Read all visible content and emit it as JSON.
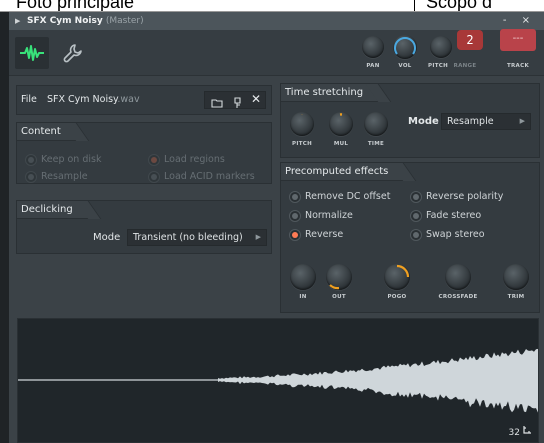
{
  "background": {
    "left_text": "Foto principale",
    "right_text": "Scopo d"
  },
  "window": {
    "title": "SFX Cym Noisy",
    "subtitle": "(Master)",
    "controls": "- ×"
  },
  "toolbar": {
    "knobs": {
      "pan": "PAN",
      "vol": "VOL",
      "pitch": "PITCH",
      "range": "RANGE",
      "track": "TRACK"
    },
    "range_value": "2",
    "track_value": "---"
  },
  "file": {
    "label": "File",
    "name": "SFX Cym Noisy",
    "ext": ".wav"
  },
  "content": {
    "title": "Content",
    "options": [
      {
        "label": "Keep on disk",
        "on": false
      },
      {
        "label": "Load regions",
        "on": true
      },
      {
        "label": "Resample",
        "on": false
      },
      {
        "label": "Load ACID markers",
        "on": false
      }
    ]
  },
  "declicking": {
    "title": "Declicking",
    "mode_label": "Mode",
    "mode_value": "Transient (no bleeding)"
  },
  "time_stretching": {
    "title": "Time stretching",
    "knobs": [
      "PITCH",
      "MUL",
      "TIME"
    ],
    "mode_label": "Mode",
    "mode_value": "Resample"
  },
  "precomputed": {
    "title": "Precomputed effects",
    "options": [
      {
        "label": "Remove DC offset",
        "on": false
      },
      {
        "label": "Reverse polarity",
        "on": false
      },
      {
        "label": "Normalize",
        "on": false
      },
      {
        "label": "Fade stereo",
        "on": false
      },
      {
        "label": "Reverse",
        "on": true
      },
      {
        "label": "Swap stereo",
        "on": false
      }
    ],
    "knobs": [
      "IN",
      "OUT",
      "POGO",
      "CROSSFADE",
      "TRIM"
    ]
  },
  "waveform": {
    "zoom_value": "32"
  },
  "colors": {
    "accent": "#ff7b55",
    "knob_ring": "#f0a020",
    "vol_ring": "#4aa8e0",
    "wave": "#cfd6da",
    "range_bg": "#a83838",
    "track_bg": "#b9434a"
  }
}
